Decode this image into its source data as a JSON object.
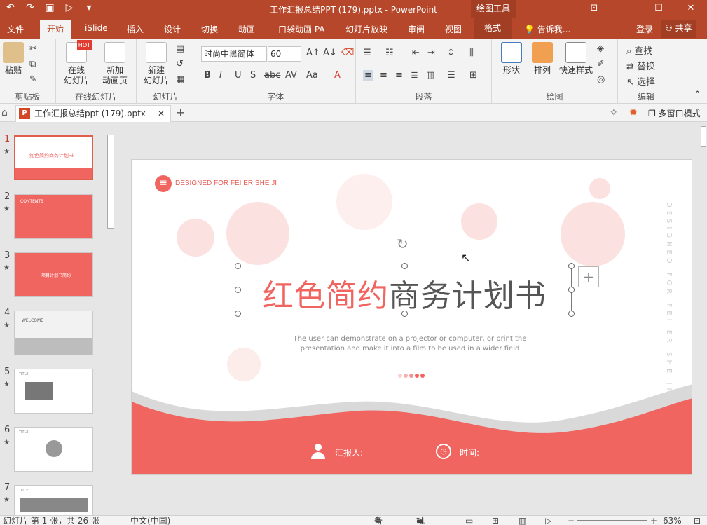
{
  "window": {
    "title": "工作汇报总结PPT (179).pptx - PowerPoint",
    "context_tab_group": "绘图工具",
    "buttons": [
      "restore-icon",
      "minimize-icon",
      "maximize-icon",
      "close-icon"
    ]
  },
  "tabs": [
    "文件",
    "开始",
    "iSlide",
    "插入",
    "设计",
    "切换",
    "动画",
    "口袋动画 PA",
    "幻灯片放映",
    "审阅",
    "视图",
    "格式"
  ],
  "active_tab": "开始",
  "tell_me": "告诉我...",
  "login": "登录",
  "share": "共享",
  "ribbon": {
    "clipboard": {
      "paste": "粘贴",
      "label": "剪贴板"
    },
    "online": {
      "online_slide": "在线\n幻灯片",
      "new_anim": "新加\n动画页",
      "label": "在线幻灯片",
      "hot": "HOT"
    },
    "slides": {
      "new_slide": "新建\n幻灯片",
      "label": "幻灯片"
    },
    "font": {
      "family": "时尚中黑简体",
      "size": "60",
      "label": "字体"
    },
    "paragraph": {
      "label": "段落"
    },
    "drawing": {
      "shape": "形状",
      "arrange": "排列",
      "quick_style": "快速样式",
      "label": "绘图"
    },
    "editing": {
      "find": "查找",
      "replace": "替换",
      "select": "选择",
      "label": "编辑"
    }
  },
  "doc_tab": {
    "name": "工作汇报总结ppt (179).pptx",
    "multi_window": "多窗口模式",
    "pp": "P"
  },
  "thumbnails": [
    {
      "num": "1",
      "title": "红色简约商务计划书"
    },
    {
      "num": "2",
      "title": "CONTENTS"
    },
    {
      "num": "3",
      "title": "项目计划书简约"
    },
    {
      "num": "4",
      "title": "WELCOME"
    },
    {
      "num": "5",
      "title": "TITLE"
    },
    {
      "num": "6",
      "title": "TITLE"
    },
    {
      "num": "7",
      "title": "TITLE"
    }
  ],
  "slide": {
    "designed": "DESIGNED FOR FEI ER SHE JI",
    "vertical_text": "DESIGNED FOR FEI ER SHE JI",
    "title_red": "红色简约",
    "title_gray": "商务计划书",
    "subtitle": "The user can demonstrate on a projector or computer, or print the presentation and make it into a film to be used in a wider field",
    "reporter": "汇报人:",
    "time": "时间:",
    "accent": "#f06560",
    "wave_gray": "#d9d9d9"
  },
  "status": {
    "slide_info": "幻灯片 第 1 张，共 26 张",
    "language": "中文(中国)",
    "notes": "备注",
    "comments": "批注",
    "zoom": "63%"
  }
}
